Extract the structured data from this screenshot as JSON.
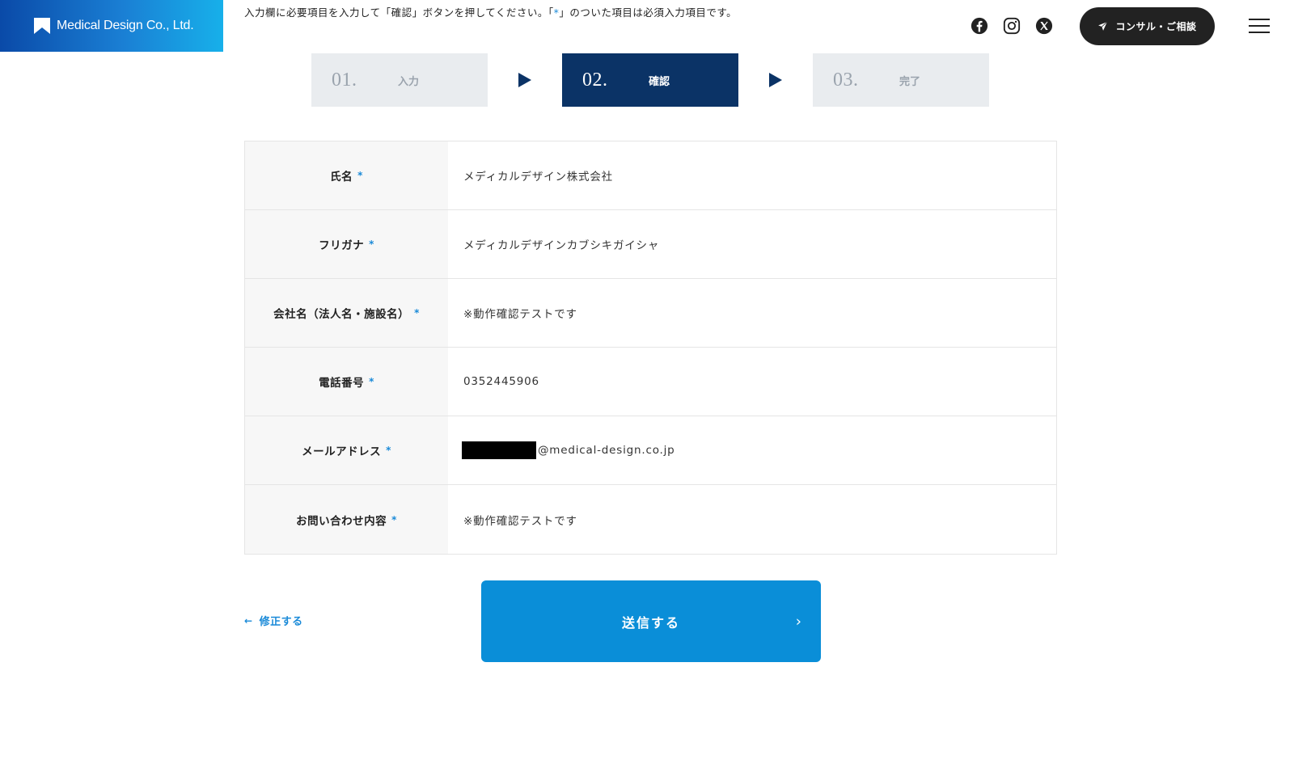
{
  "logo": {
    "text": "Medical Design Co., Ltd."
  },
  "intro": {
    "before": "入力欄に必要項目を入力して「確認」ボタンを押してください。「",
    "star": "*",
    "after": "」のついた項目は必須入力項目です。"
  },
  "header": {
    "social": [
      "facebook-icon",
      "instagram-icon",
      "x-icon"
    ],
    "consult_label": "コンサル・ご相談"
  },
  "steps": [
    {
      "num": "01.",
      "label": "入力",
      "active": false
    },
    {
      "num": "02.",
      "label": "確認",
      "active": true
    },
    {
      "num": "03.",
      "label": "完了",
      "active": false
    }
  ],
  "form": {
    "required_mark": "*",
    "rows": [
      {
        "label": "氏名",
        "value": "メディカルデザイン株式会社"
      },
      {
        "label": "フリガナ",
        "value": "メディカルデザインカブシキガイシャ"
      },
      {
        "label": "会社名（法人名・施設名）",
        "value": "※動作確認テストです"
      },
      {
        "label": "電話番号",
        "value": "0352445906"
      },
      {
        "label": "メールアドレス",
        "value": "@medical-design.co.jp"
      },
      {
        "label": "お問い合わせ内容",
        "value": "※動作確認テストです"
      }
    ]
  },
  "actions": {
    "back_label": "修正する",
    "submit_label": "送信する"
  },
  "colors": {
    "brand_gradient_start": "#0a4aa8",
    "brand_gradient_end": "#17b0ea",
    "active_step": "#0b3366",
    "accent": "#1a8ad8",
    "submit": "#0a8ed8"
  }
}
